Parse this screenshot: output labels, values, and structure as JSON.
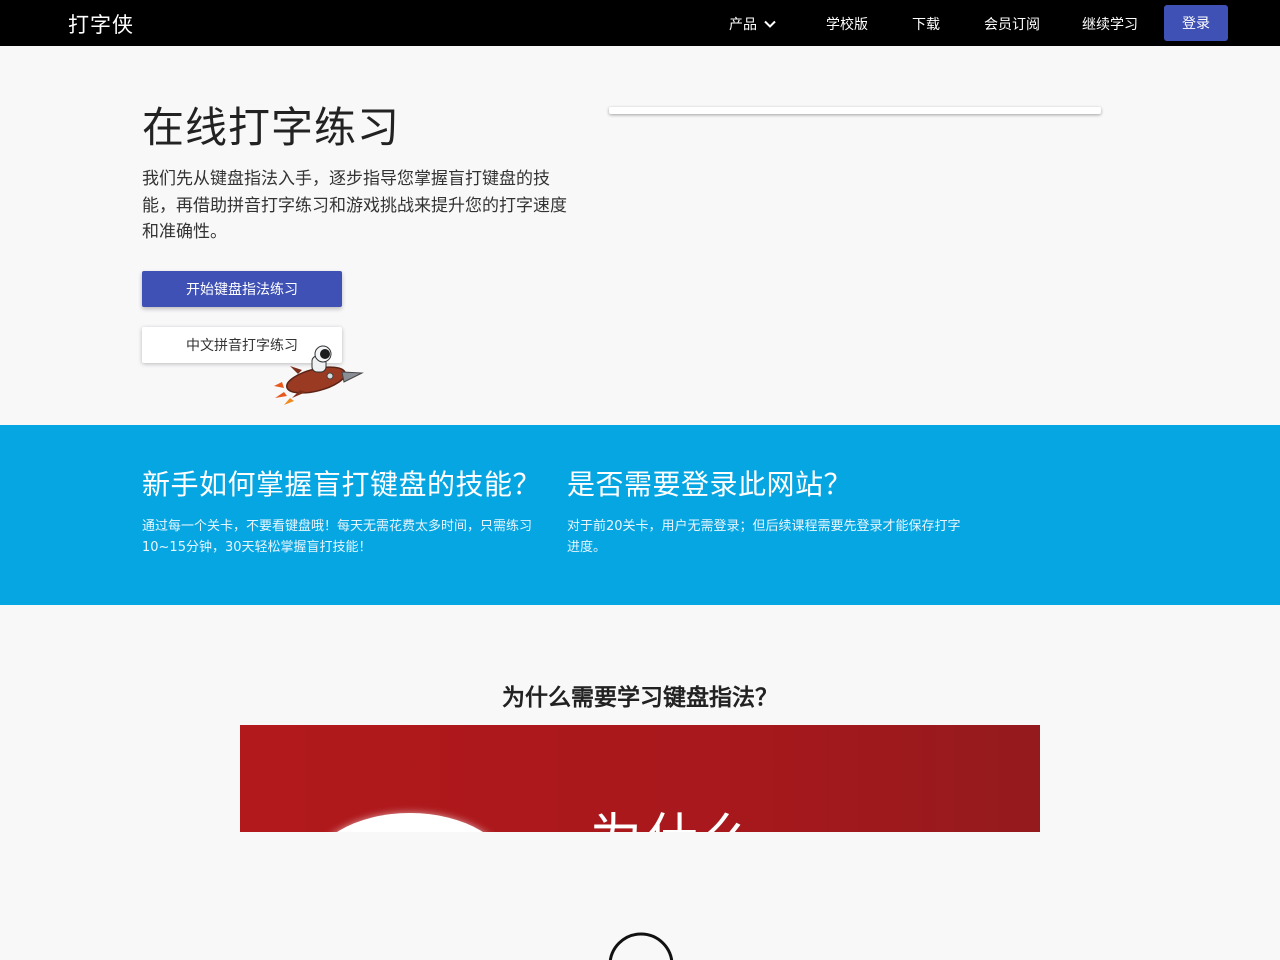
{
  "header": {
    "logo": "打字侠",
    "nav": {
      "products": "产品",
      "school": "学校版",
      "download": "下载",
      "membership": "会员订阅",
      "continue": "继续学习"
    },
    "login": "登录"
  },
  "hero": {
    "title": "在线打字练习",
    "description": "我们先从键盘指法入手，逐步指导您掌握盲打键盘的技能，再借助拼音打字练习和游戏挑战来提升您的打字速度和准确性。",
    "primary_button": "开始键盘指法练习",
    "secondary_button": "中文拼音打字练习"
  },
  "features": [
    {
      "title": "新手如何掌握盲打键盘的技能？",
      "text": "通过每一个关卡，不要看键盘哦！每天无需花费太多时间，只需练习10~15分钟，30天轻松掌握盲打技能！"
    },
    {
      "title": "是否需要登录此网站？",
      "text": "对于前20关卡，用户无需登录；但后续课程需要先登录才能保存打字进度。"
    }
  ],
  "why": {
    "title": "为什么需要学习键盘指法？",
    "video_text": "为什么"
  },
  "icons": {
    "products_chevron": "chevron-down-icon",
    "mascot": "rocket-astronaut-icon",
    "loader": "loading-spinner-icon"
  },
  "colors": {
    "topbar": "#000000",
    "accent": "#3f51b5",
    "band": "#06a6e3",
    "video_red": "#b2191c"
  }
}
